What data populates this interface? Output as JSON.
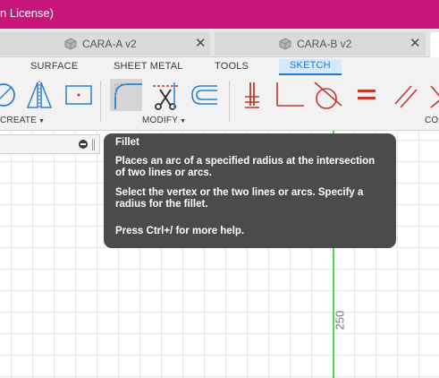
{
  "titlebar": {
    "title": "n License)",
    "color": "#c8157a"
  },
  "tabs": [
    {
      "label": "CARA-A v2",
      "close": "✕"
    },
    {
      "label": "CARA-B v2",
      "close": "✕"
    }
  ],
  "ribbon": {
    "tabs": [
      "SURFACE",
      "SHEET METAL",
      "TOOLS",
      "SKETCH"
    ],
    "active_tab": "SKETCH",
    "groups": {
      "create": "CREATE",
      "modify": "MODIFY",
      "constraints": "CO"
    }
  },
  "tools": {
    "create": [
      "circle-icon",
      "mirror-icon",
      "point-rectangle-icon"
    ],
    "modify": [
      "fillet-icon",
      "trim-icon",
      "offset-icon"
    ],
    "constraints": [
      "horizontal-vertical-icon",
      "coincident-icon",
      "tangent-icon",
      "equal-icon",
      "parallel-icon",
      "perpendicular-icon"
    ]
  },
  "tooltip": {
    "title": "Fillet",
    "para1": "Places an arc of a specified radius at the intersection of two lines or arcs.",
    "para2": "Select the vertex or the two lines or arcs. Specify a radius for the fillet.",
    "help": "Press Ctrl+/ for more help."
  },
  "canvas": {
    "dimension": "250",
    "axis_color": "#4cd94c"
  },
  "accent": "#1e7ad1"
}
